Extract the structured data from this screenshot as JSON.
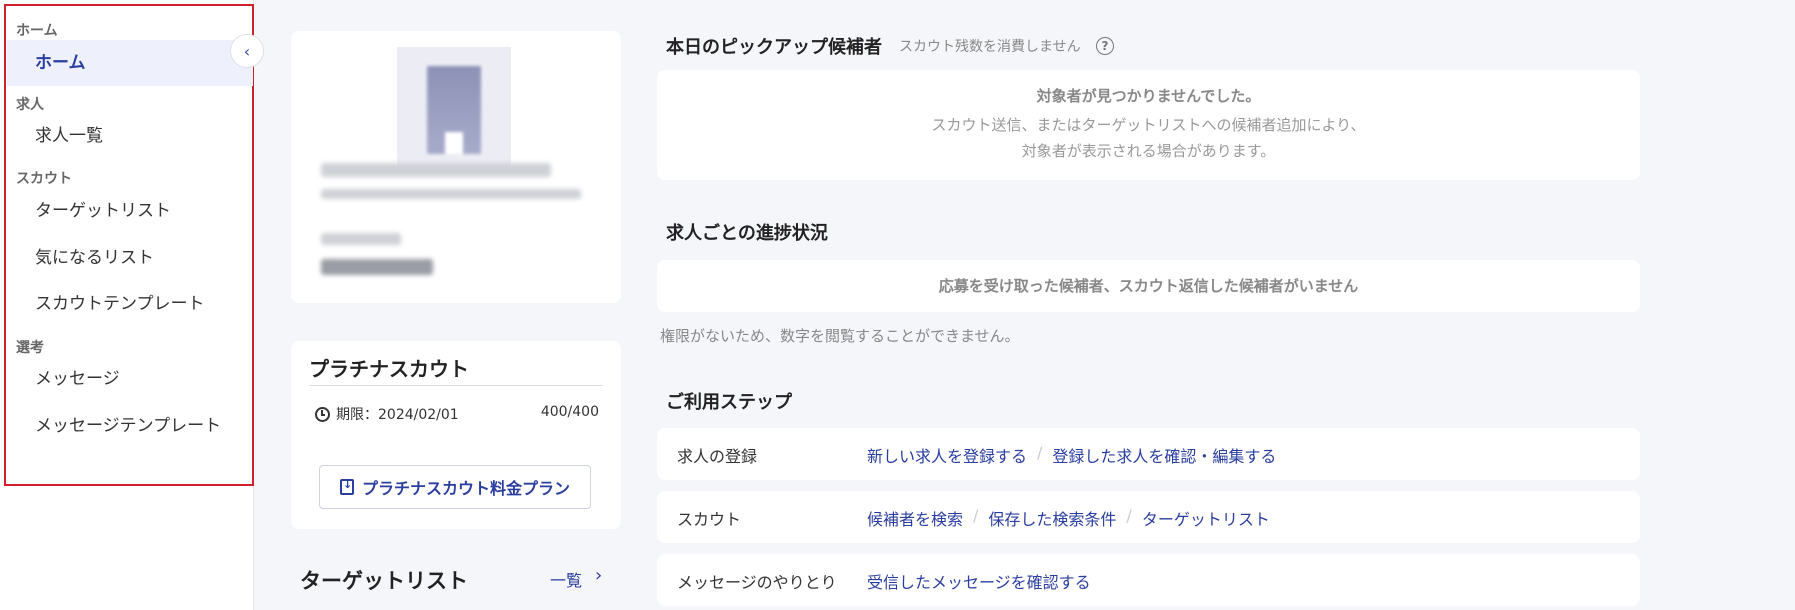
{
  "sidebar": {
    "sections": [
      {
        "label": "ホーム",
        "items": [
          "ホーム"
        ]
      },
      {
        "label": "求人",
        "items": [
          "求人一覧"
        ]
      },
      {
        "label": "スカウト",
        "items": [
          "ターゲットリスト",
          "気になるリスト",
          "スカウトテンプレート"
        ]
      },
      {
        "label": "選考",
        "items": [
          "メッセージ",
          "メッセージテンプレート"
        ]
      }
    ],
    "collapse_icon": "‹"
  },
  "platinum": {
    "title": "プラチナスカウト",
    "expiry": "期限：2024/02/01",
    "count": "400/400",
    "button": "プラチナスカウト料金プラン"
  },
  "target_list": {
    "title": "ターゲットリスト",
    "link": "一覧",
    "chevron": "›"
  },
  "pickup": {
    "title": "本日のピックアップ候補者",
    "subtitle": "スカウト残数を消費しません",
    "help": "?",
    "empty_main": "対象者が見つかりませんでした。",
    "empty_sub1": "スカウト送信、またはターゲットリストへの候補者追加により、",
    "empty_sub2": "対象者が表示される場合があります。"
  },
  "progress": {
    "title": "求人ごとの進捗状況",
    "empty": "応募を受け取った候補者、スカウト返信した候補者がいません",
    "note": "権限がないため、数字を閲覧することができません。"
  },
  "steps": {
    "title": "ご利用ステップ",
    "rows": [
      {
        "label": "求人の登録",
        "links": [
          "新しい求人を登録する",
          "登録した求人を確認・編集する"
        ]
      },
      {
        "label": "スカウト",
        "links": [
          "候補者を検索",
          "保存した検索条件",
          "ターゲットリスト"
        ]
      },
      {
        "label": "メッセージのやりとり",
        "links": [
          "受信したメッセージを確認する"
        ]
      }
    ]
  }
}
